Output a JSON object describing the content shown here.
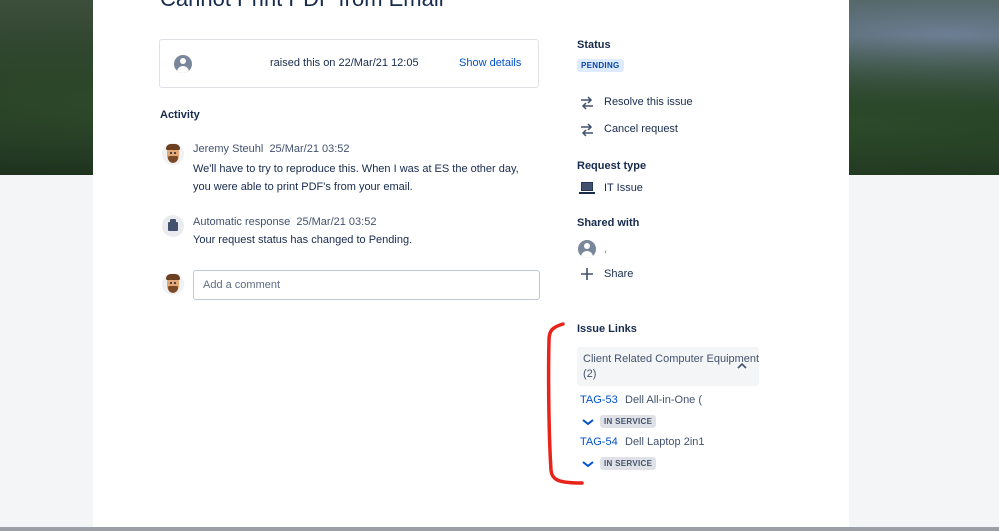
{
  "request": {
    "title": "Cannot Print PDF from Email",
    "raised_text": "raised this on 22/Mar/21 12:05",
    "show_details": "Show details"
  },
  "activity": {
    "heading": "Activity",
    "entries": [
      {
        "author": "Jeremy Steuhl",
        "time": "25/Mar/21 03:52",
        "body": "We'll have to try to reproduce this.  When I was at ES the other day, you were able to print PDF's from your email.",
        "avatar": "memoji-avatar"
      },
      {
        "author": "Automatic response",
        "time": "25/Mar/21 03:52",
        "body": "Your request status has changed to Pending.",
        "avatar": "automation-icon"
      }
    ],
    "comment_placeholder": "Add a comment"
  },
  "sidebar": {
    "status_heading": "Status",
    "status_value": "PENDING",
    "actions": [
      {
        "label": "Resolve this issue",
        "icon": "transition-arrows-icon"
      },
      {
        "label": "Cancel request",
        "icon": "transition-arrows-icon"
      }
    ],
    "request_type_heading": "Request type",
    "request_type_value": "IT Issue",
    "shared_heading": "Shared with",
    "shared_user": ",",
    "share_label": "Share",
    "issue_links_heading": "Issue Links",
    "link_group": {
      "name": "Client Related Computer Equipment",
      "count": "(2)"
    },
    "links": [
      {
        "key": "TAG-53",
        "summary": "Dell All-in-One (",
        "status": "IN SERVICE"
      },
      {
        "key": "TAG-54",
        "summary": "Dell Laptop 2in1",
        "status": "IN SERVICE"
      }
    ]
  },
  "colors": {
    "link": "#0052cc",
    "annotation": "#e8231a",
    "pending_bg": "#deebff",
    "service_bg": "#dfe1e6"
  }
}
